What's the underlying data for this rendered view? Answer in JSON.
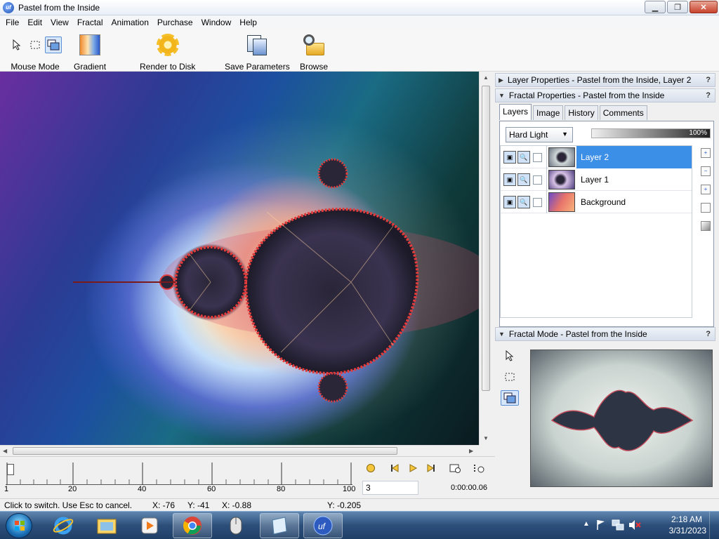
{
  "window": {
    "title": "Pastel from the Inside",
    "app_icon_text": "uf",
    "minimize": "▁",
    "maximize": "❐",
    "close": "✕"
  },
  "menu": [
    "File",
    "Edit",
    "View",
    "Fractal",
    "Animation",
    "Purchase",
    "Window",
    "Help"
  ],
  "toolbar": {
    "mouse_mode": "Mouse Mode",
    "gradient": "Gradient",
    "render": "Render to Disk",
    "save_params": "Save Parameters",
    "browse": "Browse"
  },
  "panels": {
    "layer_props": "Layer Properties - Pastel from the Inside, Layer 2",
    "fractal_props": "Fractal Properties - Pastel from the Inside",
    "fractal_mode": "Fractal Mode - Pastel from the Inside",
    "help": "?"
  },
  "tabs": [
    {
      "label": "Layers",
      "active": true
    },
    {
      "label": "Image",
      "active": false
    },
    {
      "label": "History",
      "active": false
    },
    {
      "label": "Comments",
      "active": false
    }
  ],
  "layers": {
    "blend_mode": "Hard Light",
    "opacity": "100%",
    "items": [
      {
        "name": "Layer 2",
        "selected": true
      },
      {
        "name": "Layer 1",
        "selected": false
      },
      {
        "name": "Background",
        "selected": false
      }
    ]
  },
  "timeline": {
    "tick_labels": [
      "1",
      "20",
      "40",
      "60",
      "80",
      "100"
    ],
    "frame": "3",
    "time": "0:00:00.06"
  },
  "status": {
    "hint": "Click to switch. Use Esc to cancel.",
    "x_px": "X: -76",
    "y_px": "Y: -41",
    "x_coord": "X: -0.88",
    "y_coord": "Y: -0.205"
  },
  "taskbar": {
    "time": "2:18 AM",
    "date": "3/31/2023"
  }
}
